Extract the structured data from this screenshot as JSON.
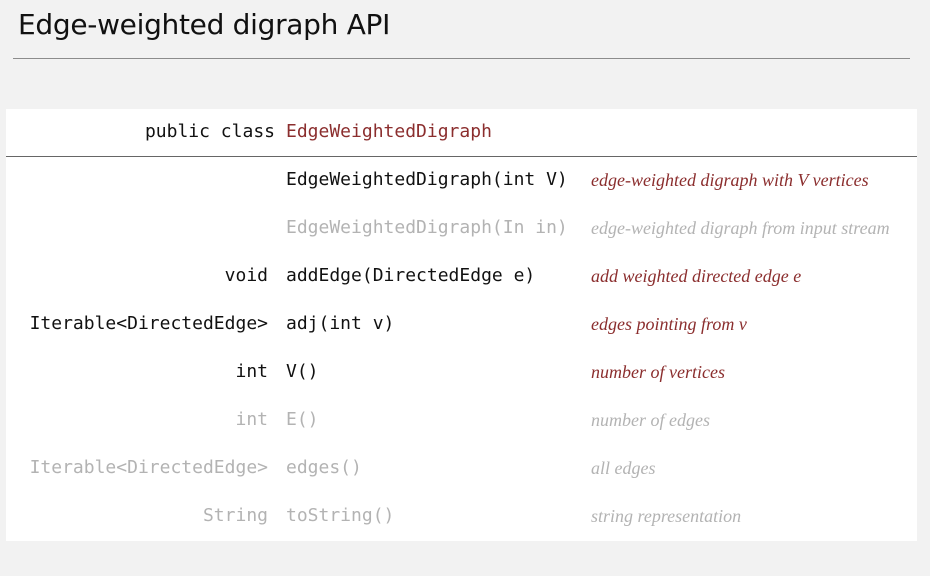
{
  "page": {
    "title": "Edge-weighted digraph API"
  },
  "api": {
    "header": {
      "keyword": "public class",
      "class_name": "EdgeWeightedDigraph"
    },
    "rows": [
      {
        "type": "",
        "method": "EdgeWeightedDigraph(int V)",
        "description": "edge-weighted digraph with V vertices",
        "emphasis": "strong"
      },
      {
        "type": "",
        "method": "EdgeWeightedDigraph(In in)",
        "description": "edge-weighted digraph from input stream",
        "emphasis": "dim"
      },
      {
        "type": "void",
        "method": "addEdge(DirectedEdge e)",
        "description": "add weighted directed edge e",
        "emphasis": "strong"
      },
      {
        "type": "Iterable<DirectedEdge>",
        "method": "adj(int v)",
        "description": "edges pointing from v",
        "emphasis": "strong"
      },
      {
        "type": "int",
        "method": "V()",
        "description": "number of vertices",
        "emphasis": "strong"
      },
      {
        "type": "int",
        "method": "E()",
        "description": "number of edges",
        "emphasis": "dim"
      },
      {
        "type": "Iterable<DirectedEdge>",
        "method": "edges()",
        "description": "all edges",
        "emphasis": "dim"
      },
      {
        "type": "String",
        "method": "toString()",
        "description": "string representation",
        "emphasis": "dim"
      }
    ]
  },
  "colors": {
    "background": "#f2f2f2",
    "panel": "#ffffff",
    "accent": "#8b2e2e",
    "text": "#111111",
    "dim_text": "#b3b3b3"
  }
}
